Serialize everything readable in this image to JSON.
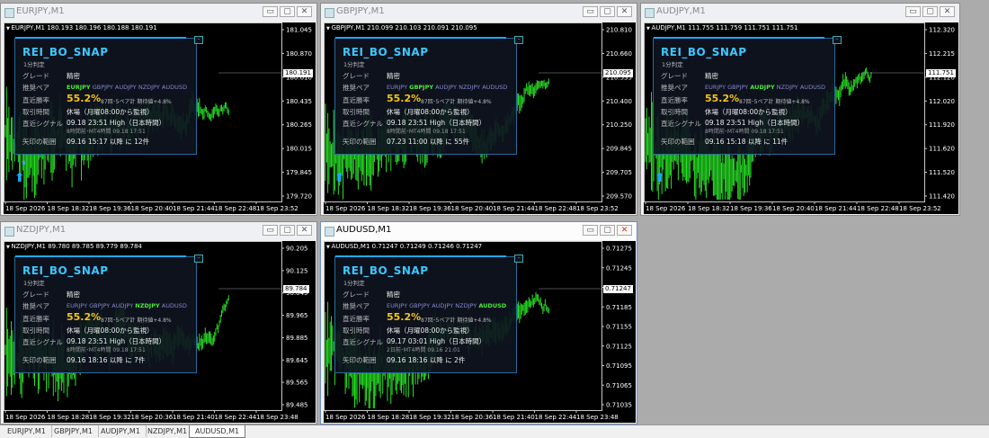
{
  "windows": [
    {
      "id": "eurjpy",
      "title": "EURJPY,M1",
      "header": "EURJPY,M1  180.193 180.196 180.188 180.191",
      "price_labels": [
        "181.045",
        "180.870",
        "180.610",
        "180.435",
        "180.265",
        "180.015",
        "179.845",
        "179.720"
      ],
      "current_price": "180.191",
      "time_labels": [
        "18 Sep 2026",
        "18 Sep 18:32",
        "18 Sep 19:36",
        "18 Sep 20:40",
        "18 Sep 21:44",
        "18 Sep 22:48",
        "18 Sep 23:52"
      ],
      "arrow": "⬆",
      "s_mark": "s"
    },
    {
      "id": "gbpjpy",
      "title": "GBPJPY,M1",
      "header": "GBPJPY,M1  210.099 210.103 210.091 210.095",
      "price_labels": [
        "210.810",
        "210.660",
        "210.535",
        "210.400",
        "210.250",
        "209.845",
        "209.705",
        "209.570"
      ],
      "current_price": "210.095",
      "time_labels": [
        "18 Sep 2026",
        "18 Sep 18:32",
        "18 Sep 19:36",
        "18 Sep 20:40",
        "18 Sep 21:44",
        "18 Sep 22:48",
        "18 Sep 23:52"
      ],
      "arrow": "⬆",
      "s_mark": ""
    },
    {
      "id": "audjpy",
      "title": "AUDJPY,M1",
      "header": "AUDJPY,M1  111.755 111.759 111.751 111.751",
      "price_labels": [
        "112.320",
        "112.215",
        "112.120",
        "112.020",
        "111.920",
        "111.620",
        "111.520",
        "111.420"
      ],
      "current_price": "111.751",
      "time_labels": [
        "18 Sep 2026",
        "18 Sep 18:32",
        "18 Sep 19:36",
        "18 Sep 20:40",
        "18 Sep 21:44",
        "18 Sep 22:48",
        "18 Sep 23:52"
      ],
      "arrow": "⬆",
      "s_mark": ""
    },
    {
      "id": "nzdjpy",
      "title": "NZDJPY,M1",
      "header": "NZDJPY,M1  89.780 89.785 89.779 89.784",
      "price_labels": [
        "90.205",
        "90.125",
        "90.045",
        "89.965",
        "89.885",
        "89.645",
        "89.565",
        "89.485"
      ],
      "current_price": "89.784",
      "time_labels": [
        "18 Sep 2026",
        "18 Sep 18:28",
        "18 Sep 19:32",
        "18 Sep 20:36",
        "18 Sep 21:40",
        "18 Sep 22:44",
        "18 Sep 23:48"
      ],
      "arrow": "",
      "s_mark": "s"
    },
    {
      "id": "audusd",
      "title": "AUDUSD,M1",
      "header": "AUDUSD,M1  0.71247 0.71249 0.71246 0.71247",
      "price_labels": [
        "0.71275",
        "0.71245",
        "0.71215",
        "0.71185",
        "0.71155",
        "0.71125",
        "0.71095",
        "0.71065",
        "0.71035"
      ],
      "current_price": "0.71247",
      "time_labels": [
        "18 Sep 2026",
        "18 Sep 18:28",
        "18 Sep 19:32",
        "18 Sep 20:36",
        "18 Sep 21:40",
        "18 Sep 22:44",
        "18 Sep 23:48"
      ],
      "arrow": "",
      "s_mark": ""
    }
  ],
  "panels": [
    {
      "title": "REI_BO_SNAP",
      "subtitle": "1分判定",
      "grade_label": "グレード",
      "grade_value": "精密",
      "pairs_label": "推奨ペア",
      "pairs": [
        "EURJPY",
        "GBPJPY",
        "AUDJPY",
        "NZDJPY",
        "AUDUSD"
      ],
      "active_pair": "EURJPY",
      "winrate_label": "直近勝率",
      "winrate": "55.2%",
      "winrate_note": "87回･5ペア計 期待値+4.8%",
      "hours_label": "取引時間",
      "hours_value": "休場（月曜08:00から監視）",
      "signal_label": "直近シグナル",
      "signal_value": "09.18 23:51 High（日本時間）",
      "signal_sub": "8時間前･MT4時間 09.18 17:51",
      "range_label": "矢印の範囲",
      "range_value": "09.16 15:17 以降 に 12件"
    },
    {
      "title": "REI_BO_SNAP",
      "subtitle": "1分判定",
      "grade_label": "グレード",
      "grade_value": "精密",
      "pairs_label": "推奨ペア",
      "pairs": [
        "EURJPY",
        "GBPJPY",
        "AUDJPY",
        "NZDJPY",
        "AUDUSD"
      ],
      "active_pair": "GBPJPY",
      "winrate_label": "直近勝率",
      "winrate": "55.2%",
      "winrate_note": "87回･5ペア計 期待値+4.8%",
      "hours_label": "取引時間",
      "hours_value": "休場（月曜08:00から監視）",
      "signal_label": "直近シグナル",
      "signal_value": "09.18 23:51 High（日本時間）",
      "signal_sub": "8時間前･MT4時間 09.18 17:51",
      "range_label": "矢印の範囲",
      "range_value": "07.23 11:00 以降 に 55件"
    },
    {
      "title": "REI_BO_SNAP",
      "subtitle": "1分判定",
      "grade_label": "グレード",
      "grade_value": "精密",
      "pairs_label": "推奨ペア",
      "pairs": [
        "EURJPY",
        "GBPJPY",
        "AUDJPY",
        "NZDJPY",
        "AUDUSD"
      ],
      "active_pair": "AUDJPY",
      "winrate_label": "直近勝率",
      "winrate": "55.2%",
      "winrate_note": "87回･5ペア計 期待値+4.8%",
      "hours_label": "取引時間",
      "hours_value": "休場（月曜08:00から監視）",
      "signal_label": "直近シグナル",
      "signal_value": "09.18 23:51 High（日本時間）",
      "signal_sub": "8時間前･MT4時間 09.18 17:51",
      "range_label": "矢印の範囲",
      "range_value": "09.16 15:18 以降 に 11件"
    },
    {
      "title": "REI_BO_SNAP",
      "subtitle": "1分判定",
      "grade_label": "グレード",
      "grade_value": "精密",
      "pairs_label": "推奨ペア",
      "pairs": [
        "EURJPY",
        "GBPJPY",
        "AUDJPY",
        "NZDJPY",
        "AUDUSD"
      ],
      "active_pair": "NZDJPY",
      "winrate_label": "直近勝率",
      "winrate": "55.2%",
      "winrate_note": "87回･5ペア計 期待値+4.8%",
      "hours_label": "取引時間",
      "hours_value": "休場（月曜08:00から監視）",
      "signal_label": "直近シグナル",
      "signal_value": "09.18 23:51 High（日本時間）",
      "signal_sub": "8時間前･MT4時間 09.18 17:51",
      "range_label": "矢印の範囲",
      "range_value": "09.16 18:16 以降 に 7件"
    },
    {
      "title": "REI_BO_SNAP",
      "subtitle": "1分判定",
      "grade_label": "グレード",
      "grade_value": "精密",
      "pairs_label": "推奨ペア",
      "pairs": [
        "EURJPY",
        "GBPJPY",
        "AUDJPY",
        "NZDJPY",
        "AUDUSD"
      ],
      "active_pair": "AUDUSD",
      "winrate_label": "直近勝率",
      "winrate": "55.2%",
      "winrate_note": "87回･5ペア計 期待値+4.8%",
      "hours_label": "取引時間",
      "hours_value": "休場（月曜08:00から監視）",
      "signal_label": "直近シグナル",
      "signal_value": "09.17 03:01 High（日本時間）",
      "signal_sub": "2日前･MT4時間 09.16 21:01",
      "range_label": "矢印の範囲",
      "range_value": "09.16 18:16 以降 に 2件"
    }
  ],
  "taskbar": {
    "tabs": [
      "EURJPY,M1",
      "GBPJPY,M1",
      "AUDJPY,M1",
      "NZDJPY,M1",
      "AUDUSD,M1"
    ],
    "active": "AUDUSD,M1"
  },
  "window_buttons": {
    "minimize": "▭",
    "maximize": "▢",
    "close": "✕"
  },
  "colors": {
    "candle": "#27e024",
    "accent": "#1ea7ff",
    "winrate": "#f5c518",
    "active_pair": "#4eea3a"
  }
}
